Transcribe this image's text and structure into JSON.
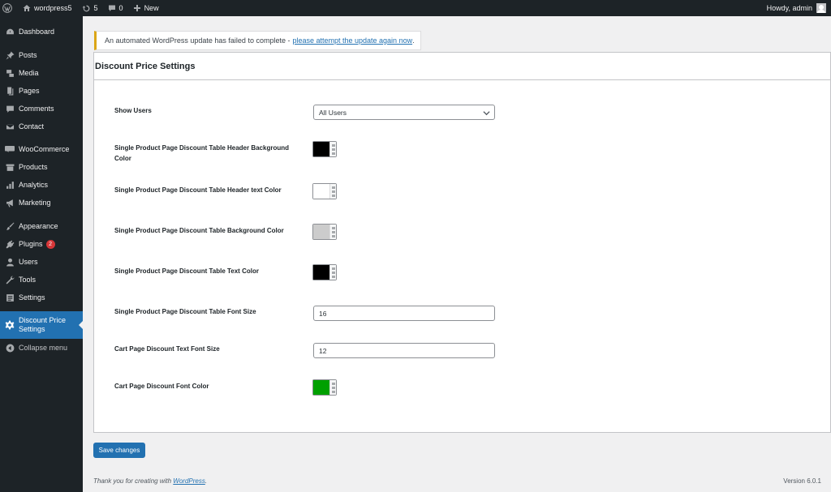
{
  "adminbar": {
    "site_name": "wordpress5",
    "updates_count": "5",
    "comments_count": "0",
    "new_label": "New",
    "greeting": "Howdy, admin",
    "icons": [
      "wordpress-logo-icon",
      "home-icon",
      "refresh-icon",
      "comment-icon",
      "plus-icon",
      "avatar"
    ]
  },
  "sidebar": {
    "items": [
      {
        "label": "Dashboard",
        "icon": "dashboard-icon"
      },
      {
        "label": "Posts",
        "icon": "pin-icon"
      },
      {
        "label": "Media",
        "icon": "media-icon"
      },
      {
        "label": "Pages",
        "icon": "pages-icon"
      },
      {
        "label": "Comments",
        "icon": "comment-icon"
      },
      {
        "label": "Contact",
        "icon": "mail-icon"
      },
      {
        "label": "WooCommerce",
        "icon": "woo-icon"
      },
      {
        "label": "Products",
        "icon": "archive-icon"
      },
      {
        "label": "Analytics",
        "icon": "bar-chart-icon"
      },
      {
        "label": "Marketing",
        "icon": "megaphone-icon"
      },
      {
        "label": "Appearance",
        "icon": "brush-icon"
      },
      {
        "label": "Plugins",
        "icon": "plug-icon",
        "badge": "2"
      },
      {
        "label": "Users",
        "icon": "user-icon"
      },
      {
        "label": "Tools",
        "icon": "wrench-icon"
      },
      {
        "label": "Settings",
        "icon": "settings-icon"
      },
      {
        "label": "Discount Price Settings",
        "icon": "gear-icon",
        "active": true
      }
    ],
    "collapse_label": "Collapse menu"
  },
  "notice": {
    "text": "An automated WordPress update has failed to complete -",
    "link": "please attempt the update again now",
    "suffix": "."
  },
  "panel": {
    "title": "Discount Price Settings",
    "show_users": {
      "label": "Show Users",
      "value": "All Users"
    },
    "header_bg": {
      "label": "Single Product Page Discount Table Header Background Color",
      "color": "#000000"
    },
    "header_text": {
      "label": "Single Product Page Discount Table Header text Color",
      "color": "#ffffff"
    },
    "table_bg": {
      "label": "Single Product Page Discount Table Background Color",
      "color": "#cccccc"
    },
    "table_text": {
      "label": "Single Product Page Discount Table Text Color",
      "color": "#000000"
    },
    "font_size": {
      "label": "Single Product Page Discount Table Font Size",
      "value": "16"
    },
    "cart_font_size": {
      "label": "Cart Page Discount Text Font Size",
      "value": "12"
    },
    "cart_font_color": {
      "label": "Cart Page Discount Font Color",
      "color": "#00a000"
    }
  },
  "save_label": "Save changes",
  "footer": {
    "text": "Thank you for creating with",
    "link": "WordPress",
    "suffix": ".",
    "version": "Version 6.0.1"
  },
  "colors": {
    "accent": "#2271b1",
    "sidebar_bg": "#1d2327",
    "notice_warning": "#dba617",
    "badge": "#d63638"
  }
}
